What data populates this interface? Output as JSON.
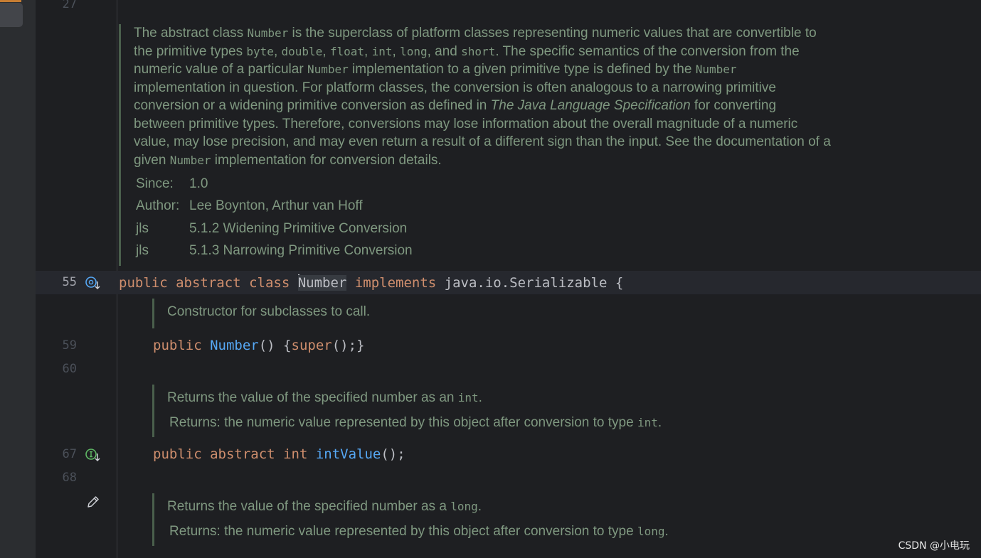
{
  "editor": {
    "line_numbers": {
      "top": "27",
      "class_decl": "55",
      "ctor": "59",
      "blank1": "60",
      "int_value": "67",
      "blank2": "68"
    },
    "class_doc": {
      "p1": "The abstract class ",
      "c1": "Number",
      "p2": " is the superclass of platform classes representing numeric values that are convertible to the primitive types ",
      "c2": "byte",
      "p3": ", ",
      "c3": "double",
      "p4": ", ",
      "c4": "float",
      "p5": ", ",
      "c5": "int",
      "p6": ", ",
      "c6": "long",
      "p7": ", and ",
      "c7": "short",
      "p8": ". The specific semantics of the conversion from the numeric value of a particular ",
      "c8": "Number",
      "p9": " implementation to a given primitive type is defined by the ",
      "c9": "Number",
      "p10": " implementation in question. For platform classes, the conversion is often analogous to a narrowing primitive conversion or a widening primitive conversion as defined in ",
      "i1": "The Java Language Specification",
      "p11": " for converting between primitive types. Therefore, conversions may lose information about the overall magnitude of a numeric value, may lose precision, and may even return a result of a different sign than the input. See the documentation of a given ",
      "c10": "Number",
      "p12": " implementation for conversion details.",
      "tags": [
        {
          "key": "Since:",
          "value": "1.0"
        },
        {
          "key": "Author:",
          "value": "Lee Boynton, Arthur van Hoff"
        },
        {
          "key": "jls",
          "value": "5.1.2 Widening Primitive Conversion"
        },
        {
          "key": "jls",
          "value": "5.1.3 Narrowing Primitive Conversion"
        }
      ]
    },
    "class_decl": {
      "kw1": "public",
      "kw2": "abstract",
      "kw3": "class",
      "name": "Number",
      "kw4": "implements",
      "rest": "java.io.Serializable {"
    },
    "ctor_doc": "Constructor for subclasses to call.",
    "ctor": {
      "kw": "public",
      "name": "Number",
      "p1": "() {",
      "kw2": "super",
      "p2": "();}"
    },
    "int_doc": {
      "summary_a": "Returns the value of the specified number as an ",
      "summary_code": "int",
      "summary_b": ".",
      "returns_label": "Returns:",
      "returns_a": " the numeric value represented by this object after conversion to type ",
      "returns_code": "int",
      "returns_b": "."
    },
    "int_value": {
      "kw1": "public",
      "kw2": "abstract",
      "kw3": "int",
      "name": "intValue",
      "rest": "();"
    },
    "long_doc": {
      "summary_a": "Returns the value of the specified number as a ",
      "summary_code": "long",
      "summary_b": ".",
      "returns_label": "Returns:",
      "returns_a": " the numeric value represented by this object after conversion to type ",
      "returns_code": "long",
      "returns_b": "."
    }
  },
  "icons": {
    "class_gutter": "overridden-method-icon",
    "method_gutter": "implemented-method-icon",
    "edit": "pencil-icon"
  },
  "colors": {
    "background": "#1e1f22",
    "keyword": "#cf8e6d",
    "function": "#56a8f5",
    "doc_text": "#7f9880",
    "code_text": "#bcbec4"
  },
  "watermark": "CSDN @小电玩"
}
